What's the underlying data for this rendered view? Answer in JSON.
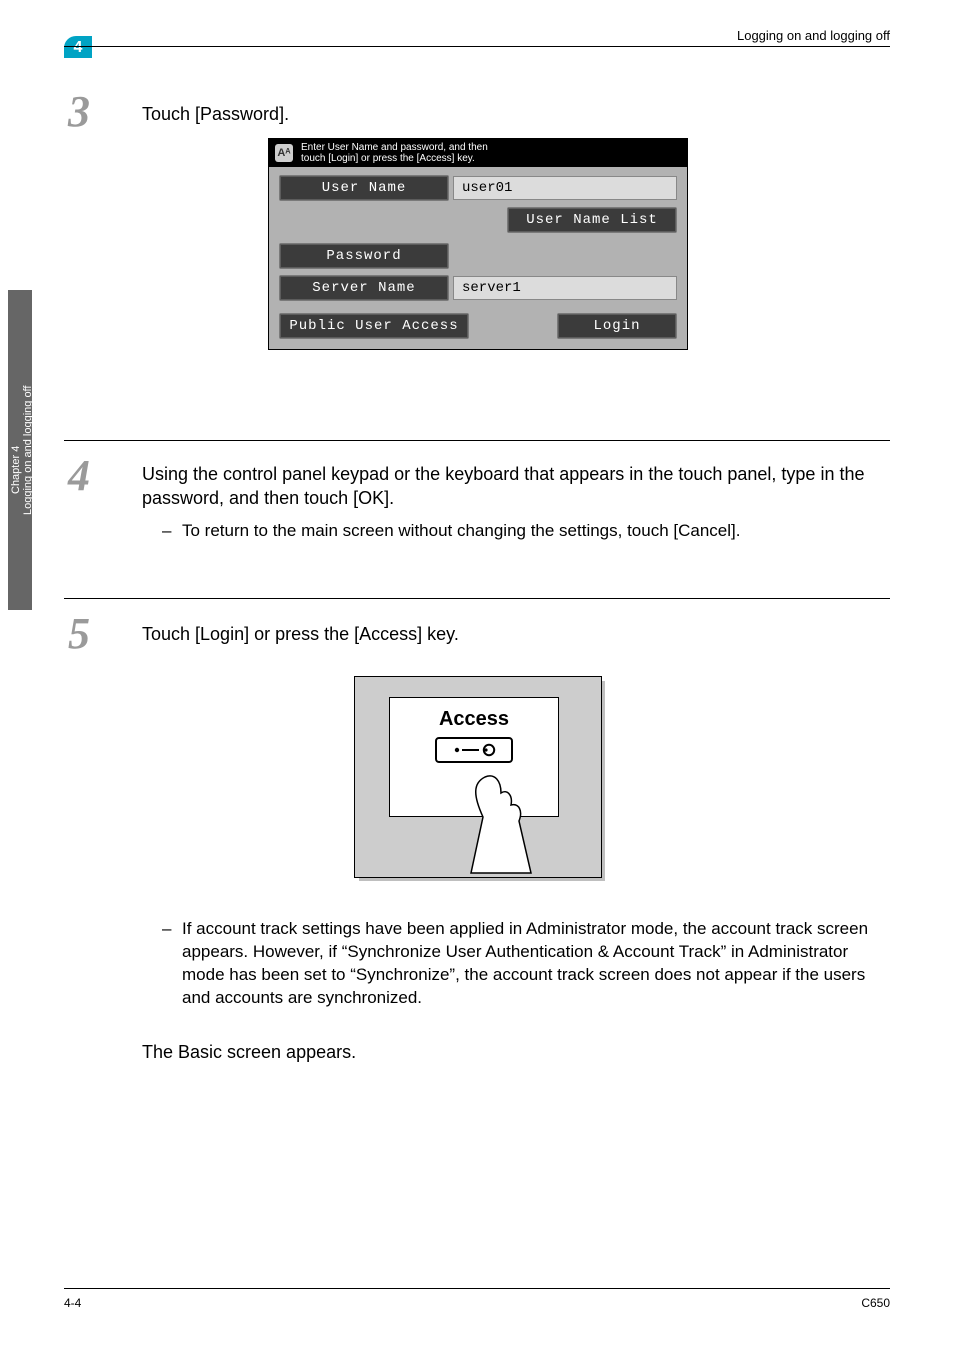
{
  "header": {
    "running_head": "Logging on and logging off",
    "chapter_badge": "4"
  },
  "side_tab": {
    "chapter_label": "Chapter 4",
    "title": "Logging on and logging off"
  },
  "steps": {
    "s3": {
      "num": "3",
      "text": "Touch [Password]."
    },
    "s4": {
      "num": "4",
      "text": "Using the control panel keypad or the keyboard that appears in the touch panel, type in the password, and then touch [OK].",
      "bullet1": "To return to the main screen without changing the settings, touch [Cancel]."
    },
    "s5": {
      "num": "5",
      "text": "Touch [Login] or press the [Access] key.",
      "bullet1": "If account track settings have been applied in Administrator mode, the account track screen appears. However, if “Synchronize User Authentication & Account Track” in Administrator mode has been set to “Synchronize”, the account track screen does not appear if the users and accounts are synchronized.",
      "after": "The Basic screen appears."
    }
  },
  "login_panel": {
    "title_line1": "Enter User Name and password, and then",
    "title_line2": "touch [Login] or press the [Access] key.",
    "user_name_label": "User Name",
    "user_name_value": "user01",
    "user_name_list": "User Name List",
    "password_label": "Password",
    "server_name_label": "Server Name",
    "server_name_value": "server1",
    "public_user": "Public User Access",
    "login": "Login",
    "icon_glyph": "Aᴬ"
  },
  "access_key": {
    "title": "Access"
  },
  "footer": {
    "left": "4-4",
    "right": "C650"
  }
}
